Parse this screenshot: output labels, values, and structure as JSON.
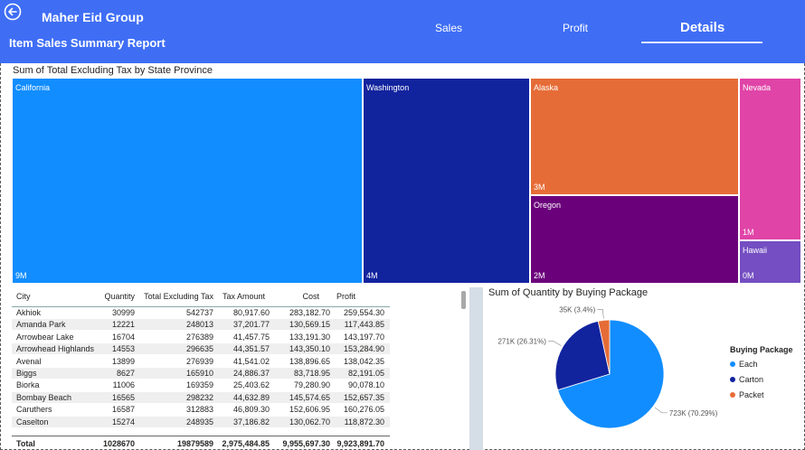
{
  "header": {
    "company": "Maher Eid Group",
    "report_title": "Item Sales Summary Report",
    "tabs": [
      {
        "label": "Sales",
        "active": false
      },
      {
        "label": "Profit",
        "active": false
      },
      {
        "label": "Details",
        "active": true
      }
    ],
    "accent": "#3f6ef5"
  },
  "treemap": {
    "title": "Sum of Total Excluding Tax by State Province",
    "tiles": [
      {
        "name": "California",
        "value_label": "9M",
        "color": "#118dff"
      },
      {
        "name": "Washington",
        "value_label": "4M",
        "color": "#12239e"
      },
      {
        "name": "Alaska",
        "value_label": "3M",
        "color": "#e66c37"
      },
      {
        "name": "Oregon",
        "value_label": "2M",
        "color": "#6b007b"
      },
      {
        "name": "Nevada",
        "value_label": "1M",
        "color": "#e044a7"
      },
      {
        "name": "Hawaii",
        "value_label": "0M",
        "color": "#744ec2"
      }
    ]
  },
  "table": {
    "columns": [
      "City",
      "Quantity",
      "Total Excluding Tax",
      "Tax Amount",
      "Cost",
      "Profit"
    ],
    "rows": [
      [
        "Akhiok",
        "30999",
        "542737",
        "80,917.60",
        "283,182.70",
        "259,554.30"
      ],
      [
        "Amanda Park",
        "12221",
        "248013",
        "37,201.77",
        "130,569.15",
        "117,443.85"
      ],
      [
        "Arrowbear Lake",
        "16704",
        "276389",
        "41,457.75",
        "133,191.30",
        "143,197.70"
      ],
      [
        "Arrowhead Highlands",
        "14553",
        "296635",
        "44,351.57",
        "143,350.10",
        "153,284.90"
      ],
      [
        "Avenal",
        "13899",
        "276939",
        "41,541.02",
        "138,896.65",
        "138,042.35"
      ],
      [
        "Biggs",
        "8627",
        "165910",
        "24,886.37",
        "83,718.95",
        "82,191.05"
      ],
      [
        "Biorka",
        "11006",
        "169359",
        "25,403.62",
        "79,280.90",
        "90,078.10"
      ],
      [
        "Bombay Beach",
        "16565",
        "298232",
        "44,632.89",
        "145,574.65",
        "152,657.35"
      ],
      [
        "Caruthers",
        "16587",
        "312883",
        "46,809.30",
        "152,606.95",
        "160,276.05"
      ],
      [
        "Caselton",
        "15274",
        "248935",
        "37,186.82",
        "130,062.70",
        "118,872.30"
      ]
    ],
    "total": [
      "Total",
      "1028670",
      "19879589",
      "2,975,484.85",
      "9,955,697.30",
      "9,923,891.70"
    ]
  },
  "chart_data": {
    "type": "pie",
    "title": "Sum of Quantity by Buying Package",
    "legend_title": "Buying Package",
    "legend_position": "right",
    "categories": [
      "Each",
      "Carton",
      "Packet"
    ],
    "values": [
      723000,
      271000,
      35000
    ],
    "percent": [
      70.29,
      26.31,
      3.4
    ],
    "data_labels": [
      "723K (70.29%)",
      "271K (26.31%)",
      "35K (3.4%)"
    ],
    "colors": [
      "#118dff",
      "#12239e",
      "#e66c37"
    ]
  }
}
